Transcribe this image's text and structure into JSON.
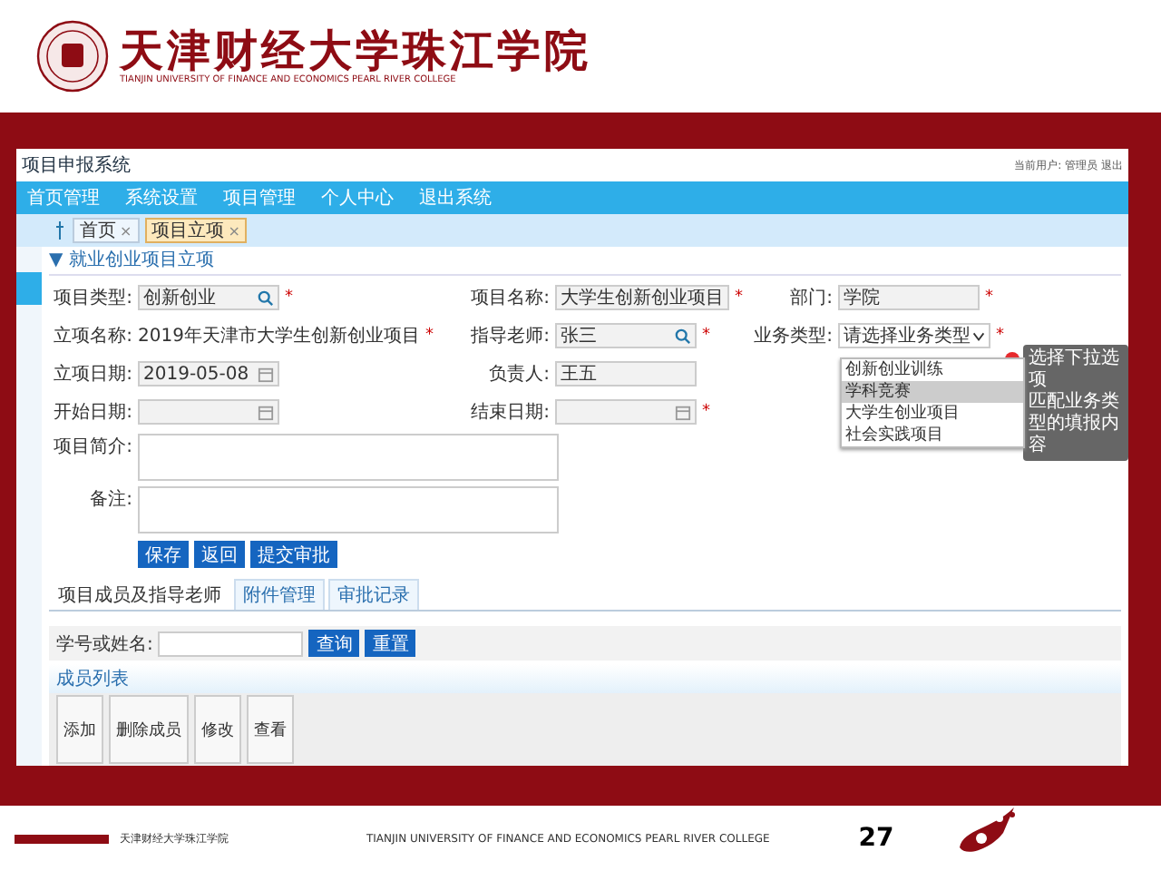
{
  "slide_header": {
    "title": "天津财经大学珠江学院",
    "subtitle": "TIANJIN UNIVERSITY OF FINANCE AND ECONOMICS PEARL RIVER COLLEGE"
  },
  "app": {
    "title": "项目申报系统",
    "user": "当前用户: 管理员  退出",
    "nav": [
      "首页管理",
      "系统设置",
      "项目管理",
      "个人中心",
      "退出系统"
    ],
    "tabs": [
      {
        "label": "首页",
        "selected": false,
        "close": "×"
      },
      {
        "label": "项目立项",
        "selected": true,
        "close": "×"
      }
    ],
    "section_title": "▼ 就业创业项目立项",
    "fields": [
      {
        "label": "项目类型:",
        "kind": "search",
        "value": "创新创业",
        "mark": "*"
      },
      {
        "label": "项目名称:",
        "kind": "readonly",
        "value": "大学生创新创业项目",
        "mark": "*"
      },
      {
        "label": "部门:",
        "kind": "text",
        "value": "学院",
        "mark": "*"
      },
      {
        "label": "立项名称:",
        "kind": "plain",
        "value": "2019年天津市大学生创新创业项目",
        "mark": "*"
      },
      {
        "label": "指导老师:",
        "kind": "search",
        "value": "张三",
        "mark": "*"
      },
      {
        "label": "业务类型:",
        "kind": "select",
        "value": "请选择业务类型",
        "mark": "*"
      },
      {
        "label": "立项日期:",
        "kind": "date",
        "value": "2019-05-08"
      },
      {
        "label": "负责人:",
        "kind": "readonly",
        "value": "王五"
      },
      {
        "kind": "empty"
      },
      {
        "label": "开始日期:",
        "kind": "date"
      },
      {
        "label": "结束日期:",
        "kind": "date",
        "mark": "*"
      }
    ],
    "textareas": [
      {
        "label": "项目简介:"
      },
      {
        "label": "备注:"
      }
    ],
    "buttons": [
      "保存",
      "返回",
      "提交审批"
    ],
    "dropdown": {
      "options": [
        {
          "label": "创新创业训练",
          "selected": false
        },
        {
          "label": "学科竞赛",
          "selected": true
        },
        {
          "label": "大学生创业项目",
          "selected": false
        },
        {
          "label": "社会实践项目",
          "selected": false
        }
      ]
    },
    "tooltip": {
      "lines": [
        "选择下拉选项",
        "匹配业务类型的填报内容"
      ]
    },
    "bottom_tabs": [
      {
        "label": "项目成员及指导老师",
        "selected": true
      },
      {
        "label": "附件管理",
        "selected": false
      },
      {
        "label": "审批记录",
        "selected": false
      }
    ],
    "search": {
      "label": "学号或姓名:",
      "buttons": [
        "查询",
        "重置"
      ]
    },
    "list_title": "成员列表",
    "toolbar": [
      "添加",
      "删除成员",
      "修改",
      "查看"
    ]
  },
  "footer": {
    "college": "天津财经大学珠江学院",
    "english": "TIANJIN UNIVERSITY OF FINANCE AND ECONOMICS PEARL RIVER COLLEGE",
    "page": "27"
  }
}
